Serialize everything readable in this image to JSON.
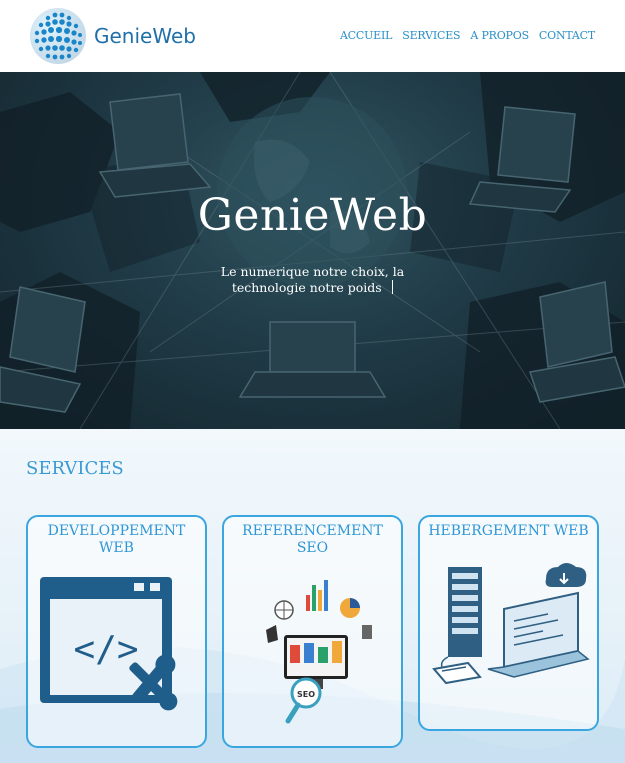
{
  "brand": {
    "name": "GenieWeb"
  },
  "nav": {
    "items": [
      {
        "label": "ACCUEIL"
      },
      {
        "label": "SERVICES"
      },
      {
        "label": "A PROPOS"
      },
      {
        "label": "CONTACT"
      }
    ]
  },
  "hero": {
    "title": "GenieWeb",
    "subtitle": "Le numerique notre choix, la technologie notre poids"
  },
  "services": {
    "title": "SERVICES",
    "cards": [
      {
        "title": "DEVELOPPEMENT WEB",
        "icon": "code-window-icon"
      },
      {
        "title": "REFERENCEMENT SEO",
        "icon": "seo-analytics-icon",
        "badge": "SEO"
      },
      {
        "title": "HEBERGEMENT WEB",
        "icon": "server-cloud-icon"
      }
    ]
  },
  "colors": {
    "accent": "#2a8fc9",
    "card_border": "#3aa6e0",
    "hero_overlay": "#1c3440"
  }
}
